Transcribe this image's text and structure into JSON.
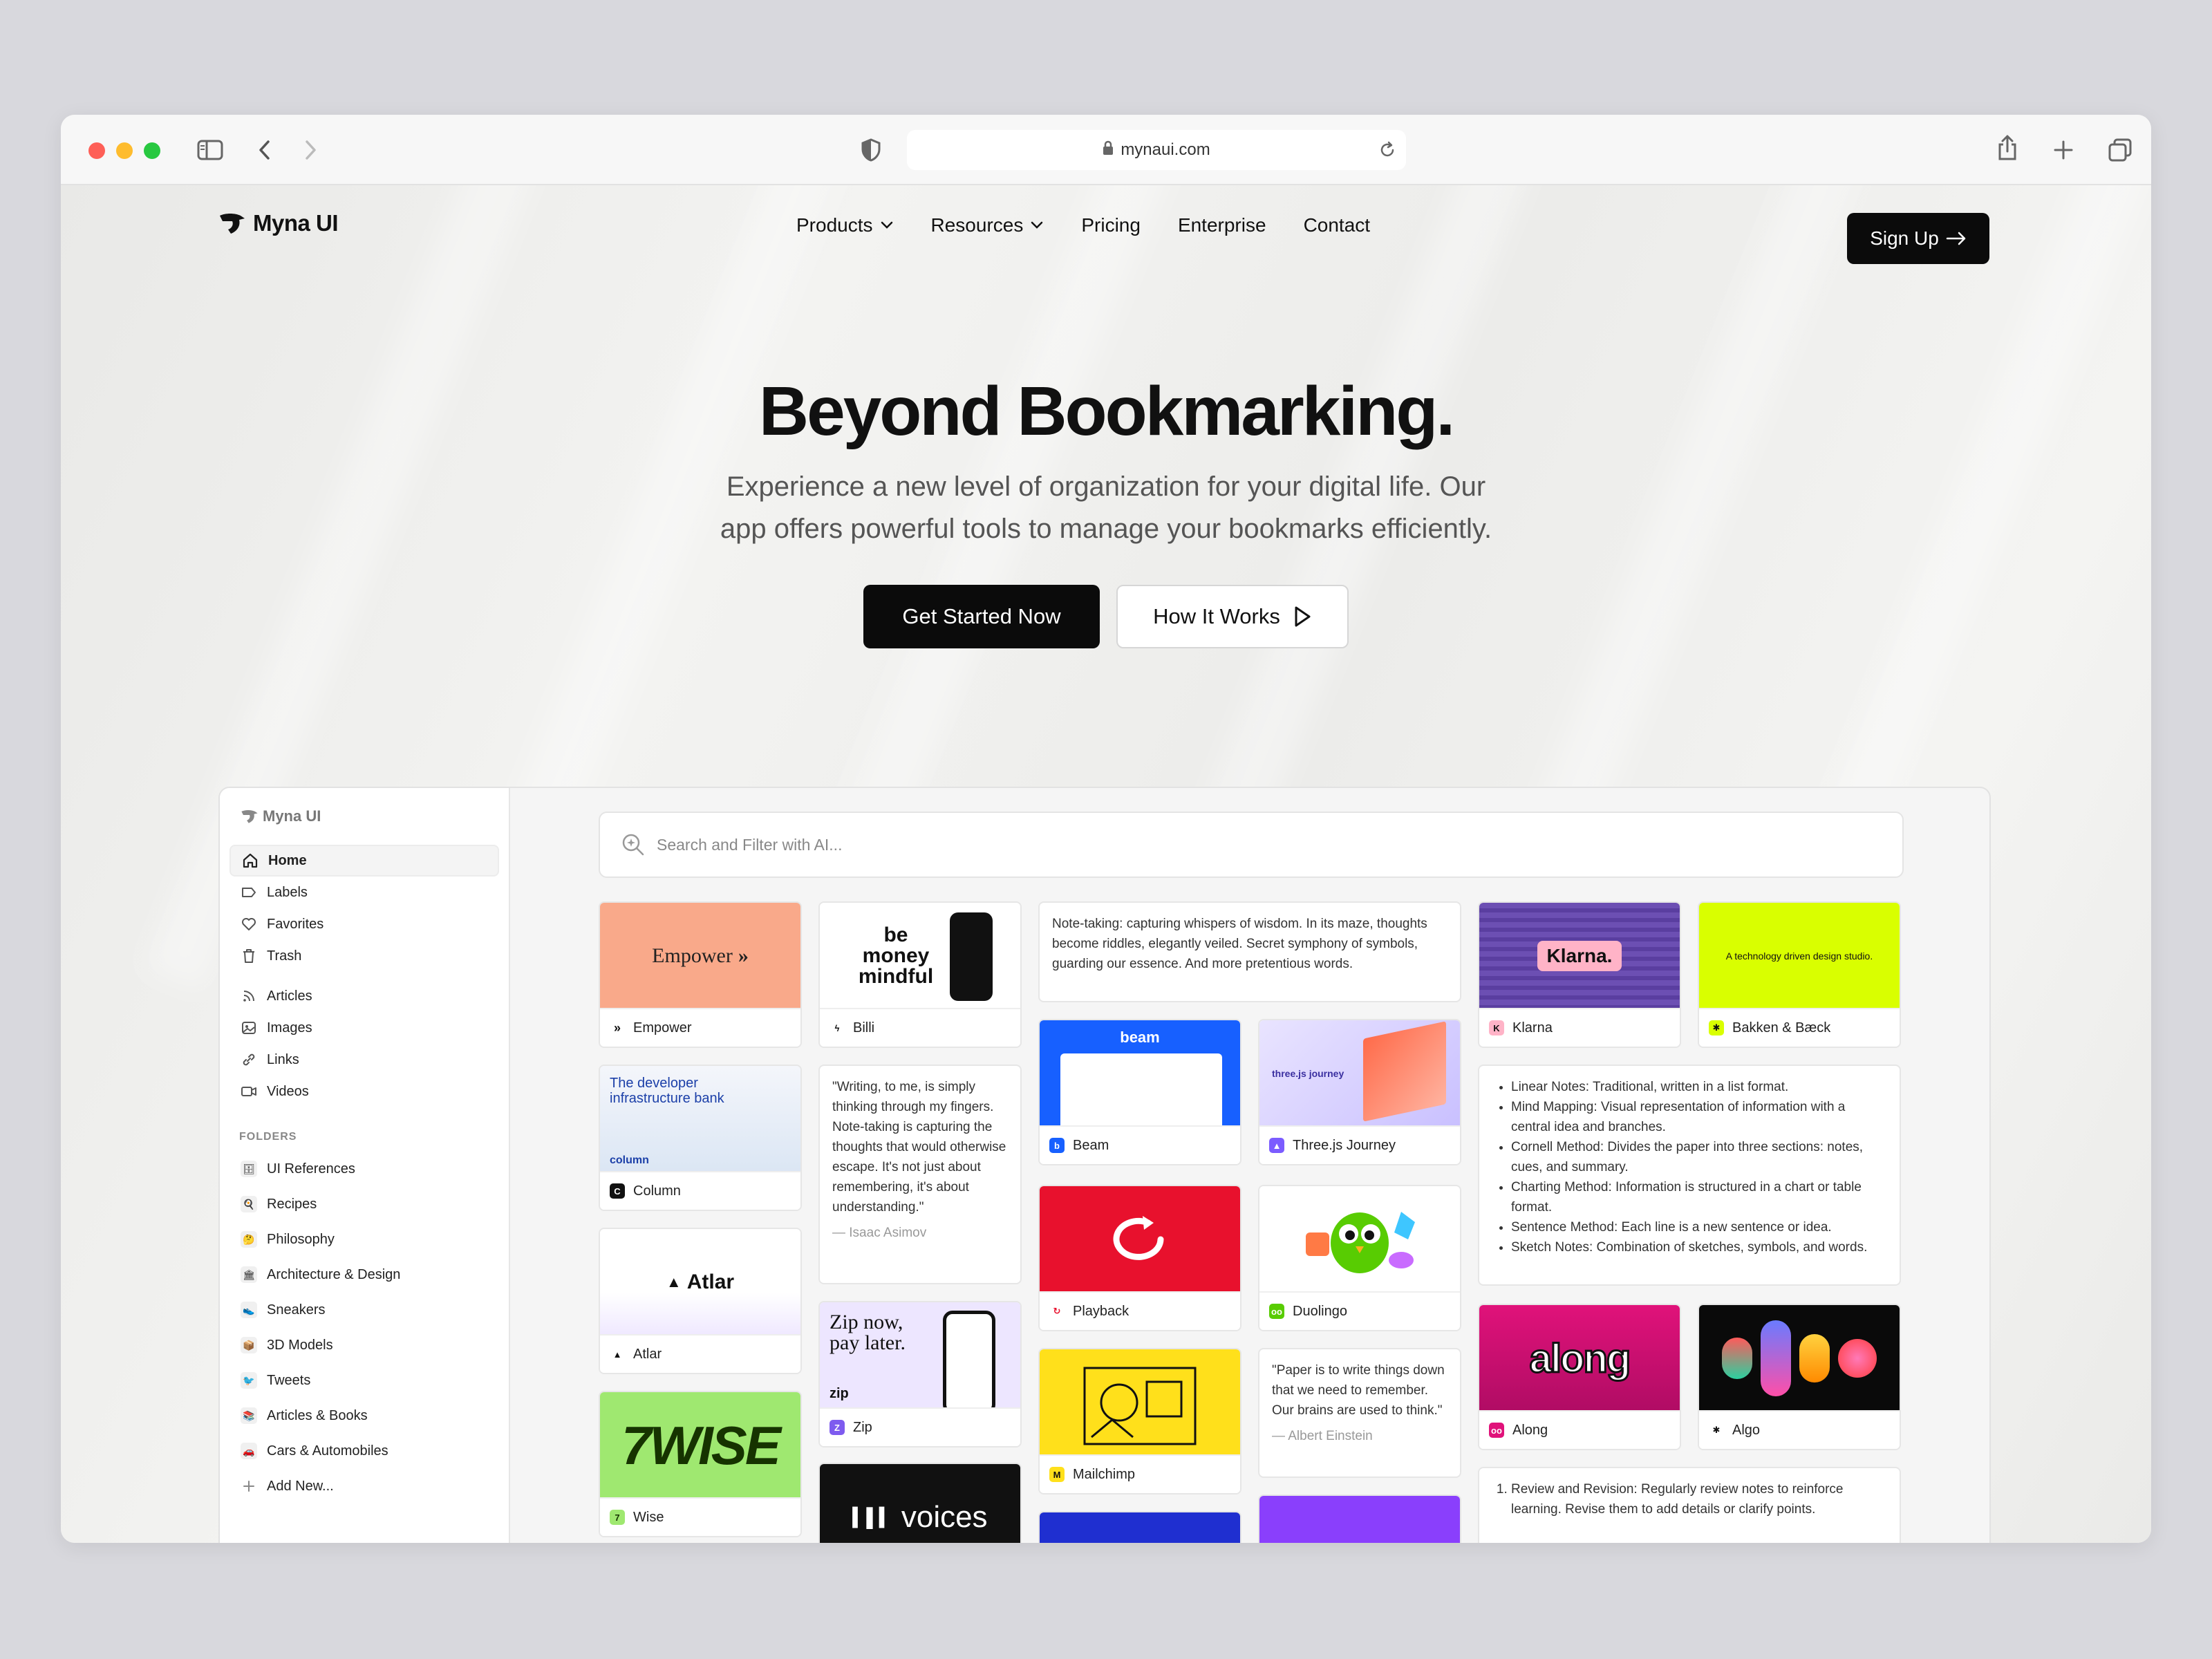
{
  "browser": {
    "url": "mynaui.com"
  },
  "nav": {
    "brand": "Myna UI",
    "items": [
      "Products",
      "Resources",
      "Pricing",
      "Enterprise",
      "Contact"
    ],
    "signup": "Sign Up"
  },
  "hero": {
    "title": "Beyond Bookmarking.",
    "subtitle_line1": "Experience a new level of organization for your digital life. Our",
    "subtitle_line2": "app offers powerful tools to manage your bookmarks efficiently.",
    "cta_primary": "Get Started Now",
    "cta_secondary": "How It Works"
  },
  "app": {
    "brand": "Myna UI",
    "sidebar": {
      "main": [
        {
          "label": "Home",
          "icon": "home-icon"
        },
        {
          "label": "Labels",
          "icon": "label-icon"
        },
        {
          "label": "Favorites",
          "icon": "heart-icon"
        },
        {
          "label": "Trash",
          "icon": "trash-icon"
        }
      ],
      "types": [
        {
          "label": "Articles",
          "icon": "rss-icon"
        },
        {
          "label": "Images",
          "icon": "image-icon"
        },
        {
          "label": "Links",
          "icon": "link-icon"
        },
        {
          "label": "Videos",
          "icon": "video-icon"
        }
      ],
      "folders_heading": "FOLDERS",
      "folders": [
        {
          "label": "UI References",
          "emoji": "🗄️"
        },
        {
          "label": "Recipes",
          "emoji": "🍳"
        },
        {
          "label": "Philosophy",
          "emoji": "🤔"
        },
        {
          "label": "Architecture & Design",
          "emoji": "🏛️"
        },
        {
          "label": "Sneakers",
          "emoji": "👟"
        },
        {
          "label": "3D Models",
          "emoji": "📦"
        },
        {
          "label": "Tweets",
          "emoji": "🐦"
        },
        {
          "label": "Articles & Books",
          "emoji": "📚"
        },
        {
          "label": "Cars & Automobiles",
          "emoji": "🚗"
        }
      ],
      "add_new": "Add New..."
    },
    "search_placeholder": "Search and Filter with AI...",
    "cards": {
      "empower": {
        "title": "Empower",
        "thumb_text": "Empower"
      },
      "column": {
        "title": "Column",
        "thumb_text": "The developer infrastructure bank",
        "thumb_sub": "column"
      },
      "atlar": {
        "title": "Atlar",
        "thumb_text": "Atlar"
      },
      "wise": {
        "title": "Wise",
        "thumb_text": "7WISE"
      },
      "billi": {
        "title": "Billi",
        "thumb_text": "be money mindful"
      },
      "zip": {
        "title": "Zip",
        "thumb_text": "Zip now, pay later.",
        "thumb_sub": "zip"
      },
      "voices": {
        "thumb_text": "voices"
      },
      "beam": {
        "title": "Beam",
        "thumb_text": "beam"
      },
      "playback": {
        "title": "Playback"
      },
      "mailchimp": {
        "title": "Mailchimp"
      },
      "threejs": {
        "title": "Three.js Journey",
        "thumb_text": "three.js journey"
      },
      "duolingo": {
        "title": "Duolingo"
      },
      "klarna": {
        "title": "Klarna",
        "thumb_text": "Klarna."
      },
      "bakken": {
        "title": "Bakken & Bæck",
        "thumb_text": "A technology driven design studio."
      },
      "along": {
        "title": "Along",
        "thumb_text": "along"
      },
      "algo": {
        "title": "Algo"
      }
    },
    "notes": {
      "notetaking": "Note-taking: capturing whispers of wisdom. In its maze, thoughts become riddles, elegantly veiled. Secret symphony of symbols, guarding our essence. And more pretentious words.",
      "asimov_quote": "\"Writing, to me, is simply thinking through my fingers. Note-taking is capturing the thoughts that would otherwise escape. It's not just about remembering, it's about understanding.\"",
      "asimov_author": "— Isaac Asimov",
      "einstein_quote": "\"Paper is to write things down that we need to remember. Our brains are used to think.\"",
      "einstein_author": "— Albert Einstein",
      "methods": [
        "Linear Notes: Traditional, written in a list format.",
        "Mind Mapping: Visual representation of information with a central idea and branches.",
        "Cornell Method: Divides the paper into three sections: notes, cues, and summary.",
        "Charting Method: Information is structured in a chart or table format.",
        "Sentence Method: Each line is a new sentence or idea.",
        "Sketch Notes: Combination of sketches, symbols, and words."
      ],
      "review": "Review and Revision: Regularly review notes to reinforce learning. Revise them to add details or clarify points."
    }
  }
}
